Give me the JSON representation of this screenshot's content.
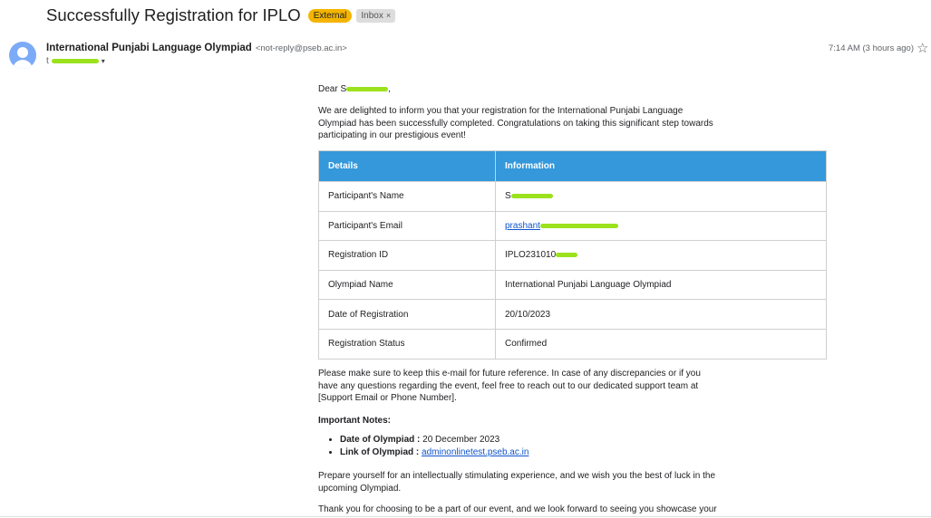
{
  "email": {
    "subject": "Successfully Registration for IPLO",
    "badge_external": "External",
    "badge_inbox": "Inbox",
    "badge_inbox_close": "×",
    "sender_name": "International Punjabi Language Olympiad",
    "sender_email": "<not-reply@pseb.ac.in>",
    "to_prefix": "t",
    "time": "7:14 AM (3 hours ago)",
    "star_icon": "☆",
    "caret_icon": "▾"
  },
  "body": {
    "greeting_prefix": "Dear S",
    "greeting_suffix": ",",
    "intro": "We are delighted to inform you that your registration for the International Punjabi Language Olympiad has been successfully completed. Congratulations on taking this significant step towards participating in our prestigious event!",
    "table": {
      "headers": [
        "Details",
        "Information"
      ],
      "rows": [
        {
          "label": "Participant's Name",
          "value": "S"
        },
        {
          "label": "Participant's Email",
          "value": "prashant"
        },
        {
          "label": "Registration ID",
          "value": "IPLO231010"
        },
        {
          "label": "Olympiad Name",
          "value": "International Punjabi Language Olympiad"
        },
        {
          "label": "Date of Registration",
          "value": "20/10/2023"
        },
        {
          "label": "Registration Status",
          "value": "Confirmed"
        }
      ]
    },
    "reference_note": "Please make sure to keep this e-mail for future reference. In case of any discrepancies or if you have any questions regarding the event, feel free to reach out to our dedicated support team at [Support Email or Phone Number].",
    "important_notes_title": "Important Notes:",
    "notes": {
      "date_label": "Date of Olympiad :",
      "date_value": " 20 December 2023",
      "link_label": "Link of Olympiad :",
      "link_value": "adminonlinetest.pseb.ac.in"
    },
    "prepare": "Prepare yourself for an intellectually stimulating experience, and we wish you the best of luck in the upcoming Olympiad.",
    "thanks": "Thank you for choosing to be a part of our event, and we look forward to seeing you showcase your"
  },
  "colors": {
    "header_blue": "#3498db",
    "external_badge": "#f4b400",
    "redaction": "#9be21d"
  }
}
